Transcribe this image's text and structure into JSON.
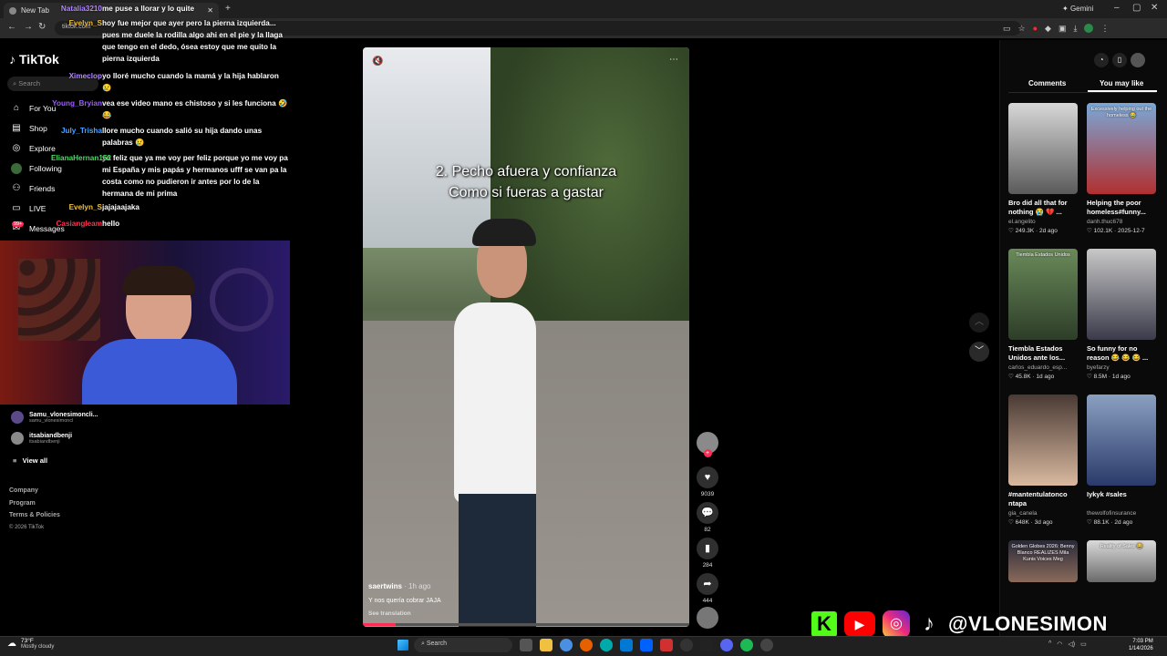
{
  "browser": {
    "tab_title": "New Tab",
    "gemini_label": "Gemini",
    "url": "tiktok.com"
  },
  "chat": [
    {
      "user": "Natalia3210",
      "color": "#b388ff",
      "msg": "me puse a llorar y lo quite"
    },
    {
      "user": "Evelyn_S",
      "color": "#f0c040",
      "msg": "hoy fue mejor que ayer pero la pierna izquierda... pues me duele la rodilla algo ahi en el pie y la llaga que tengo en el dedo, ósea estoy que me quito la pierna izquierda"
    },
    {
      "user": "Ximeclop",
      "color": "#b388ff",
      "msg": "yo lloré mucho cuando la mamá y la hija hablaron 😢"
    },
    {
      "user": "Young_Bryian",
      "color": "#9b5cff",
      "msg": "vea ese video mano es chistoso y si les funciona 🤣😂"
    },
    {
      "user": "July_Trisha",
      "color": "#4aa3ff",
      "msg": "llore mucho cuando salió su hija dando unas palabras 😢"
    },
    {
      "user": "ElianaHernan152",
      "color": "#4cd964",
      "msg": "yo feliz que ya me voy per feliz porque yo me voy pa mi España y mis papás y hermanos ufff se van pa la costa como no pudieron ir antes por lo de la hermana de mi prima"
    },
    {
      "user": "Evelyn_S",
      "color": "#f0c040",
      "msg": "jajajaajaka"
    },
    {
      "user": "Casiangleam",
      "color": "#ff3050",
      "msg": "hello"
    }
  ],
  "tiktok": {
    "logo": "TikTok",
    "search_placeholder": "Search",
    "nav": [
      "For You",
      "Shop",
      "Explore",
      "Following",
      "Friends",
      "LIVE",
      "Messages"
    ],
    "messages_badge": "99+",
    "following_accounts": [
      {
        "name": "Samu_vlonesimoncli...",
        "handle": "samu_vlonesimoncl"
      },
      {
        "name": "itsabiandbenji",
        "handle": "itsabiandbenji"
      }
    ],
    "view_all": "View all",
    "footer": [
      "Company",
      "Program",
      "Terms & Policies",
      "© 2026 TikTok"
    ]
  },
  "video": {
    "caption_line1": "2. Pecho afuera y confianza",
    "caption_line2": "Como si fueras a gastar",
    "author": "saertwins",
    "time_ago": "1h ago",
    "description": "Y nos quería cobrar JAJA",
    "see_translation": "See translation",
    "likes": "9039",
    "comments": "82",
    "saves": "284",
    "shares": "444"
  },
  "right_panel": {
    "tabs": [
      "Comments",
      "You may like"
    ],
    "active_tab": "You may like",
    "cards": [
      {
        "title": "Bro did all that for nothing 😭 💔 ...",
        "author": "el.angelito",
        "stats": "♡ 249.3K · 2d ago",
        "colors": [
          "#d8d8d8",
          "#5a5a5a"
        ]
      },
      {
        "title": "Helping the poor homeless#funny...",
        "author": "danh.thuc678",
        "stats": "♡ 102.1K · 2025-12-7",
        "colors": [
          "#7aa8d8",
          "#b03030"
        ]
      },
      {
        "title": "Tiembla Estados Unidos ante los...",
        "author": "carlos_eduardo_esp...",
        "stats": "♡ 45.8K · 1d ago",
        "colors": [
          "#6a8a5a",
          "#2d3d28"
        ]
      },
      {
        "title": "So funny for no reason 😂 😂 😂 ...",
        "author": "byefarzy",
        "stats": "♡ 8.5M · 1d ago",
        "colors": [
          "#c8c8c8",
          "#3a3a4a"
        ]
      },
      {
        "title": "#mantentulatonco ntapa",
        "author": "gia_canela",
        "stats": "♡ 648K · 3d ago",
        "colors": [
          "#4a3a34",
          "#d9b9a0"
        ]
      },
      {
        "title": "Iykyk #sales",
        "author": "thewolfofinsurance",
        "stats": "♡ 88.1K · 2d ago",
        "colors": [
          "#8aa0c0",
          "#2a3a6a"
        ]
      },
      {
        "title": "",
        "author": "",
        "stats": "",
        "colors": [
          "#2a2a3a",
          "#8a6a5a"
        ]
      },
      {
        "title": "",
        "author": "",
        "stats": "",
        "colors": [
          "#dadada",
          "#6a6a6a"
        ]
      }
    ]
  },
  "card_overlays": {
    "card2": "Excessively helping out the homeless 😂",
    "card3": "Tiembla Estados Unidos",
    "card7": "Golden Globes 2026: Benny Blanco REALIZES Mila Kunis Voices Meg",
    "card8": "Reality of Sales 😂"
  },
  "brand": {
    "handle": "@VLONESIMON"
  },
  "taskbar": {
    "weather_temp": "73°F",
    "weather_desc": "Mostly cloudy",
    "search": "Search",
    "time": "7:03 PM",
    "date": "1/14/2026"
  }
}
